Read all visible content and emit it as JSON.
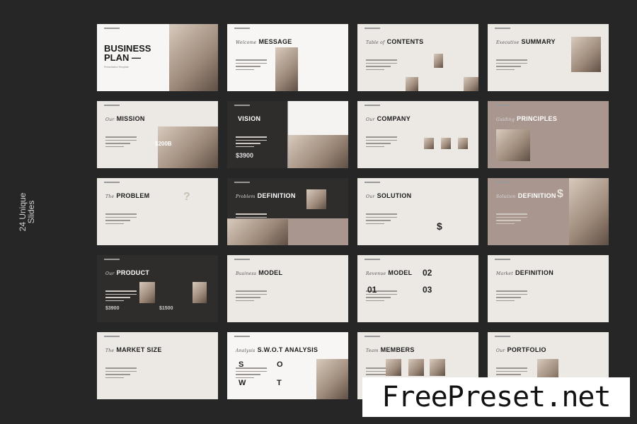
{
  "side_label": {
    "line1": "24 Unique",
    "line2": "Slides"
  },
  "cover": {
    "title": "BUSINESS PLAN —",
    "subtitle": "Presentation Template"
  },
  "slides": [
    {
      "script": "",
      "title": "",
      "theme": "white",
      "extra": ""
    },
    {
      "script": "Welcome",
      "title": "MESSAGE",
      "theme": "white",
      "extra": ""
    },
    {
      "script": "Table of",
      "title": "CONTENTS",
      "theme": "light",
      "extra": ""
    },
    {
      "script": "Executive",
      "title": "SUMMARY",
      "theme": "light",
      "extra": ""
    },
    {
      "script": "Our",
      "title": "MISSION",
      "theme": "light",
      "extra": "$200B"
    },
    {
      "script": "",
      "title": "VISION",
      "theme": "dark",
      "extra": "$3900"
    },
    {
      "script": "Our",
      "title": "COMPANY",
      "theme": "light",
      "extra": ""
    },
    {
      "script": "Guiding",
      "title": "PRINCIPLES",
      "theme": "mauve",
      "extra": ""
    },
    {
      "script": "The",
      "title": "PROBLEM",
      "theme": "light",
      "extra": "?"
    },
    {
      "script": "Problem",
      "title": "DEFINITION",
      "theme": "dark",
      "extra": ""
    },
    {
      "script": "Our",
      "title": "SOLUTION",
      "theme": "light",
      "extra": "$"
    },
    {
      "script": "Solution",
      "title": "DEFINITION",
      "theme": "mauve",
      "extra": "$"
    },
    {
      "script": "Our",
      "title": "PRODUCT",
      "theme": "dark",
      "extra": "$3900",
      "extra2": "$1500"
    },
    {
      "script": "Business",
      "title": "MODEL",
      "theme": "light",
      "extra": ""
    },
    {
      "script": "Revenue",
      "title": "MODEL",
      "theme": "light",
      "extra": "01",
      "extra2": "02",
      "extra3": "03"
    },
    {
      "script": "Market",
      "title": "DEFINITION",
      "theme": "light",
      "extra": ""
    },
    {
      "script": "The",
      "title": "MARKET SIZE",
      "theme": "light",
      "extra": ""
    },
    {
      "script": "Analysis",
      "title": "S.W.O.T ANALYSIS",
      "theme": "white",
      "extra": "S",
      "extra2": "O",
      "extra3": "W",
      "extra4": "T"
    },
    {
      "script": "Team",
      "title": "MEMBERS",
      "theme": "light",
      "extra": ""
    },
    {
      "script": "Our",
      "title": "PORTFOLIO",
      "theme": "light",
      "extra": ""
    }
  ],
  "watermark": "FreePreset.net"
}
